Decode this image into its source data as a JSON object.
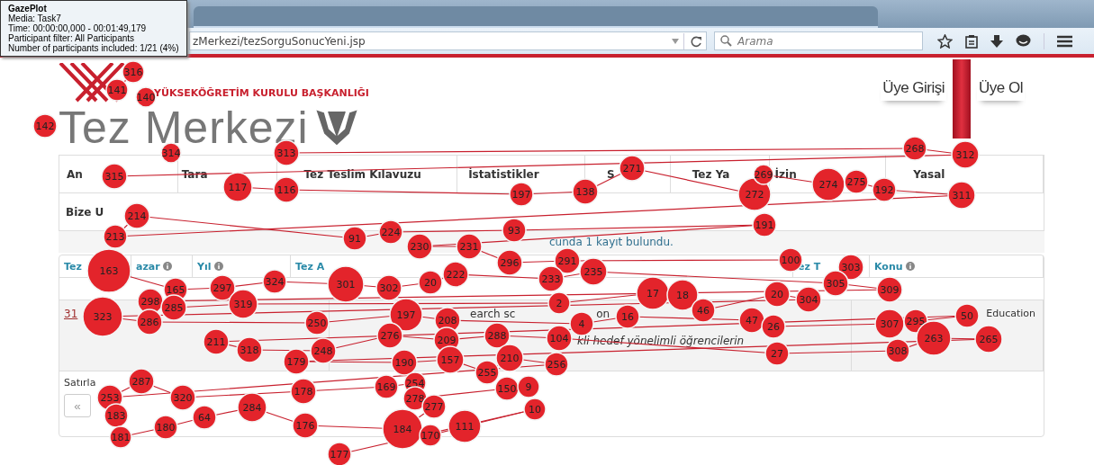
{
  "gaze_info": {
    "title": "GazePlot",
    "lines": [
      "Media: Task7",
      "Time: 00:00:00,000 - 00:01:49,179",
      "Participant filter: All Participants",
      "Number of participants included: 1/21 (4%)"
    ]
  },
  "browser": {
    "url": "zMerkezi/tezSorguSonucYeni.jsp",
    "search_placeholder": "Arama"
  },
  "site": {
    "institution": "YÜKSEKÖĞRETİM KURULU BAŞKANLIĞI",
    "logo_text": "Tez Merkezi",
    "auth_links": [
      "Üye Girişi",
      "Üye Ol"
    ],
    "nav_rows": [
      [
        "An",
        "Tara",
        "Tez Teslim Kılavuzu",
        "İstatistikler",
        "S",
        "Tez Ya",
        "İzin",
        "Yasal"
      ],
      [
        "Bize U"
      ]
    ],
    "result_text": "cunda 1 kayıt bulundu.",
    "columns": [
      {
        "label": "Tez",
        "info": false
      },
      {
        "label": "azar",
        "info": true
      },
      {
        "label": "Yıl",
        "info": true
      },
      {
        "label": "Tez A",
        "info": false
      },
      {
        "label": "ez T",
        "info": false
      },
      {
        "label": "Konu",
        "info": true
      }
    ],
    "row": {
      "link": "31",
      "title_parts": [
        "earch sc",
        "on"
      ],
      "summary": "kli hedef yönelimli öğrencilerin",
      "subject": "Education"
    },
    "rows_label": "Satırla",
    "pager_first": "«"
  },
  "fixations": [
    {
      "label": "316"
    },
    {
      "label": "141"
    },
    {
      "label": "142"
    },
    {
      "label": "140"
    },
    {
      "label": "314"
    },
    {
      "label": "313"
    },
    {
      "label": "268"
    },
    {
      "label": "312"
    },
    {
      "label": "315"
    },
    {
      "label": "117"
    },
    {
      "label": "116"
    },
    {
      "label": "197"
    },
    {
      "label": "138"
    },
    {
      "label": "271"
    },
    {
      "label": "272"
    },
    {
      "label": "269"
    },
    {
      "label": "274"
    },
    {
      "label": "275"
    },
    {
      "label": "192"
    },
    {
      "label": "311"
    },
    {
      "label": "213"
    },
    {
      "label": "214"
    },
    {
      "label": "91"
    },
    {
      "label": "224"
    },
    {
      "label": "93"
    },
    {
      "label": "191"
    },
    {
      "label": "230"
    },
    {
      "label": "231"
    },
    {
      "label": "296"
    },
    {
      "label": "291"
    },
    {
      "label": "100"
    },
    {
      "label": "303"
    },
    {
      "label": "163"
    },
    {
      "label": "165"
    },
    {
      "label": "297"
    },
    {
      "label": "324"
    },
    {
      "label": "301"
    },
    {
      "label": "302"
    },
    {
      "label": "20"
    },
    {
      "label": "222"
    },
    {
      "label": "233"
    },
    {
      "label": "235"
    },
    {
      "label": "305"
    },
    {
      "label": "309"
    },
    {
      "label": "298"
    },
    {
      "label": "285"
    },
    {
      "label": "319"
    },
    {
      "label": "2"
    },
    {
      "label": "17"
    },
    {
      "label": "18"
    },
    {
      "label": "46"
    },
    {
      "label": "20"
    },
    {
      "label": "304"
    },
    {
      "label": "323"
    },
    {
      "label": "286"
    },
    {
      "label": "250"
    },
    {
      "label": "197"
    },
    {
      "label": "208"
    },
    {
      "label": "4"
    },
    {
      "label": "16"
    },
    {
      "label": "47"
    },
    {
      "label": "26"
    },
    {
      "label": "307"
    },
    {
      "label": "295"
    },
    {
      "label": "50"
    },
    {
      "label": "211"
    },
    {
      "label": "318"
    },
    {
      "label": "248"
    },
    {
      "label": "276"
    },
    {
      "label": "209"
    },
    {
      "label": "288"
    },
    {
      "label": "104"
    },
    {
      "label": "27"
    },
    {
      "label": "308"
    },
    {
      "label": "263"
    },
    {
      "label": "265"
    },
    {
      "label": "179"
    },
    {
      "label": "190"
    },
    {
      "label": "157"
    },
    {
      "label": "255"
    },
    {
      "label": "210"
    },
    {
      "label": "256"
    },
    {
      "label": "253"
    },
    {
      "label": "287"
    },
    {
      "label": "320"
    },
    {
      "label": "178"
    },
    {
      "label": "169"
    },
    {
      "label": "254"
    },
    {
      "label": "278"
    },
    {
      "label": "150"
    },
    {
      "label": "9"
    },
    {
      "label": "183"
    },
    {
      "label": "181"
    },
    {
      "label": "180"
    },
    {
      "label": "64"
    },
    {
      "label": "284"
    },
    {
      "label": "176"
    },
    {
      "label": "184"
    },
    {
      "label": "277"
    },
    {
      "label": "170"
    },
    {
      "label": "111"
    },
    {
      "label": "10"
    },
    {
      "label": "177"
    }
  ]
}
